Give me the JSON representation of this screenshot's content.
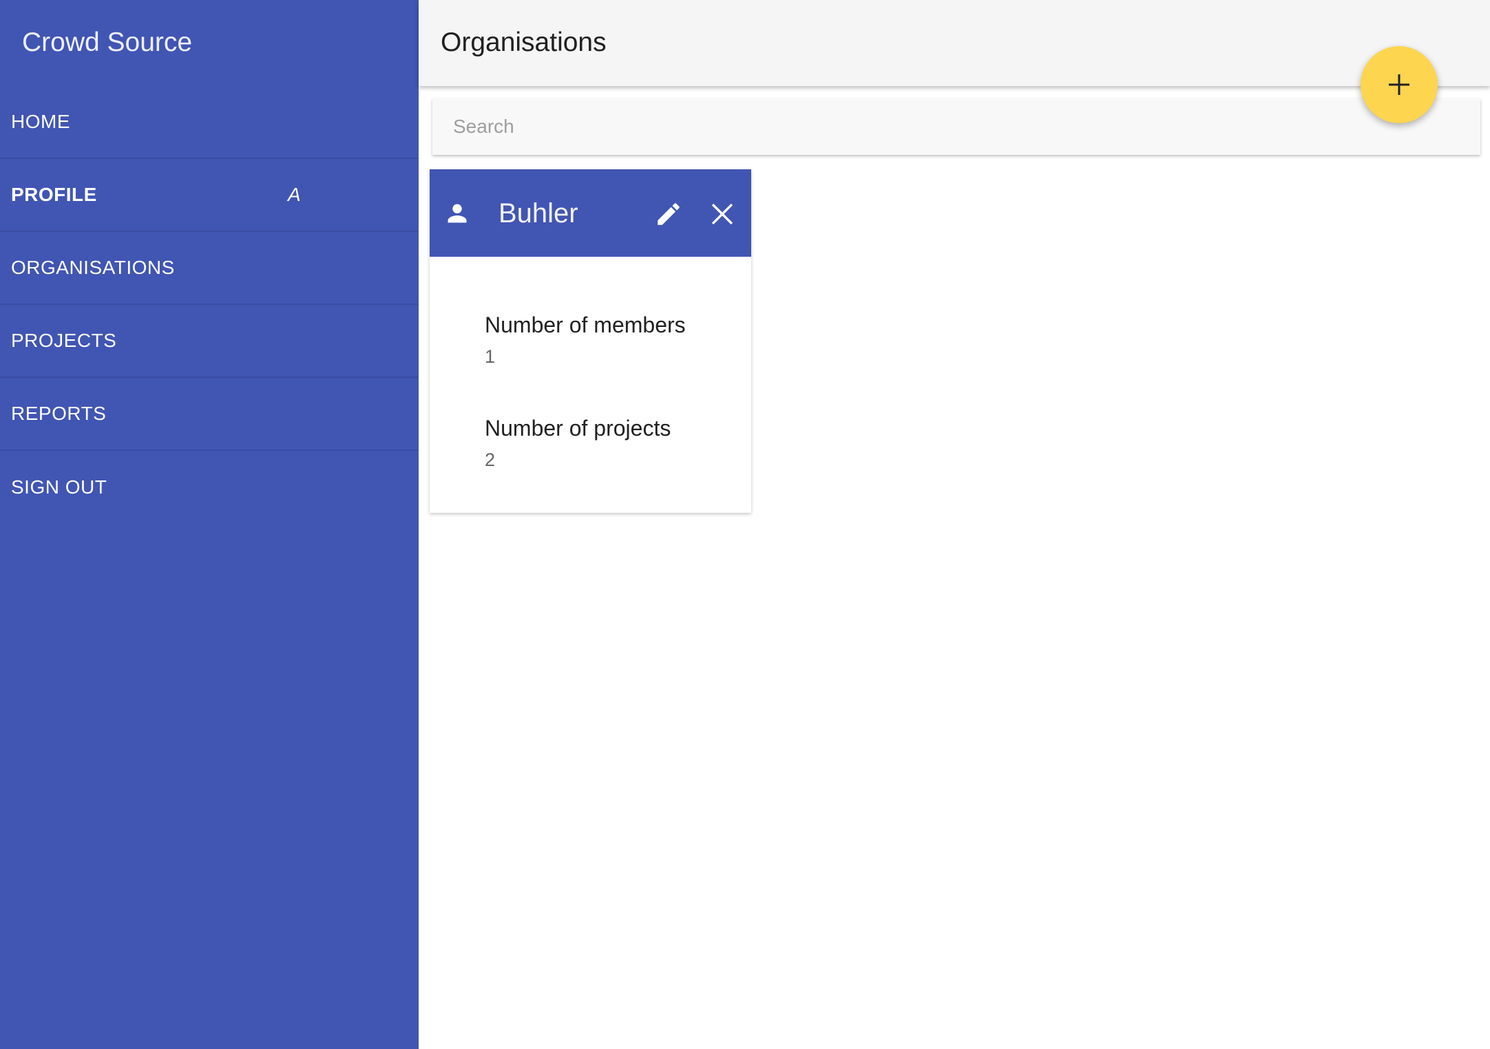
{
  "sidebar": {
    "title": "Crowd Source",
    "items": [
      {
        "label": "HOME"
      },
      {
        "label": "PROFILE",
        "badge": "A"
      },
      {
        "label": "ORGANISATIONS"
      },
      {
        "label": "PROJECTS"
      },
      {
        "label": "REPORTS"
      },
      {
        "label": "SIGN OUT"
      }
    ]
  },
  "header": {
    "title": "Organisations",
    "fab_icon": "plus-icon"
  },
  "search": {
    "placeholder": "Search",
    "value": ""
  },
  "organisations": [
    {
      "name": "Buhler",
      "icon": "person-icon",
      "actions": [
        "pencil-icon",
        "close-icon"
      ],
      "members_label": "Number of members",
      "members_value": "1",
      "projects_label": "Number of projects",
      "projects_value": "2"
    }
  ],
  "colors": {
    "primary": "#4155b3",
    "accent": "#fdd54f",
    "header_bg": "#f5f5f5"
  }
}
